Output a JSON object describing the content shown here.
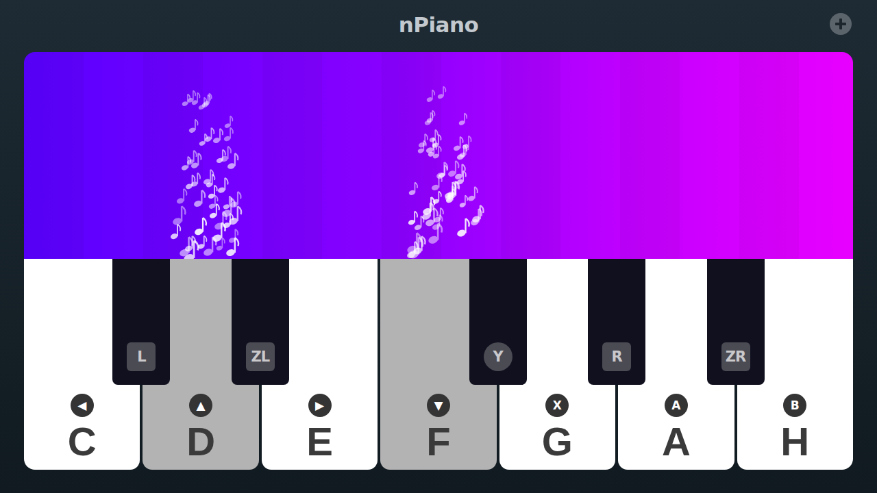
{
  "window": {
    "title": "nPiano"
  },
  "white_keys": [
    {
      "note": "C",
      "button": "◀",
      "pressed": false
    },
    {
      "note": "D",
      "button": "▲",
      "pressed": true
    },
    {
      "note": "E",
      "button": "▶",
      "pressed": false
    },
    {
      "note": "F",
      "button": "▼",
      "pressed": true
    },
    {
      "note": "G",
      "button": "X",
      "pressed": false
    },
    {
      "note": "A",
      "button": "A",
      "pressed": false
    },
    {
      "note": "H",
      "button": "B",
      "pressed": false
    }
  ],
  "black_keys": [
    {
      "button": "L",
      "kind": "square",
      "pressed": false
    },
    {
      "button": "ZL",
      "kind": "square",
      "pressed": false
    },
    {
      "button": "Y",
      "kind": "round",
      "pressed": false
    },
    {
      "button": "R",
      "kind": "square",
      "pressed": false
    },
    {
      "button": "ZR",
      "kind": "square",
      "pressed": false
    }
  ]
}
